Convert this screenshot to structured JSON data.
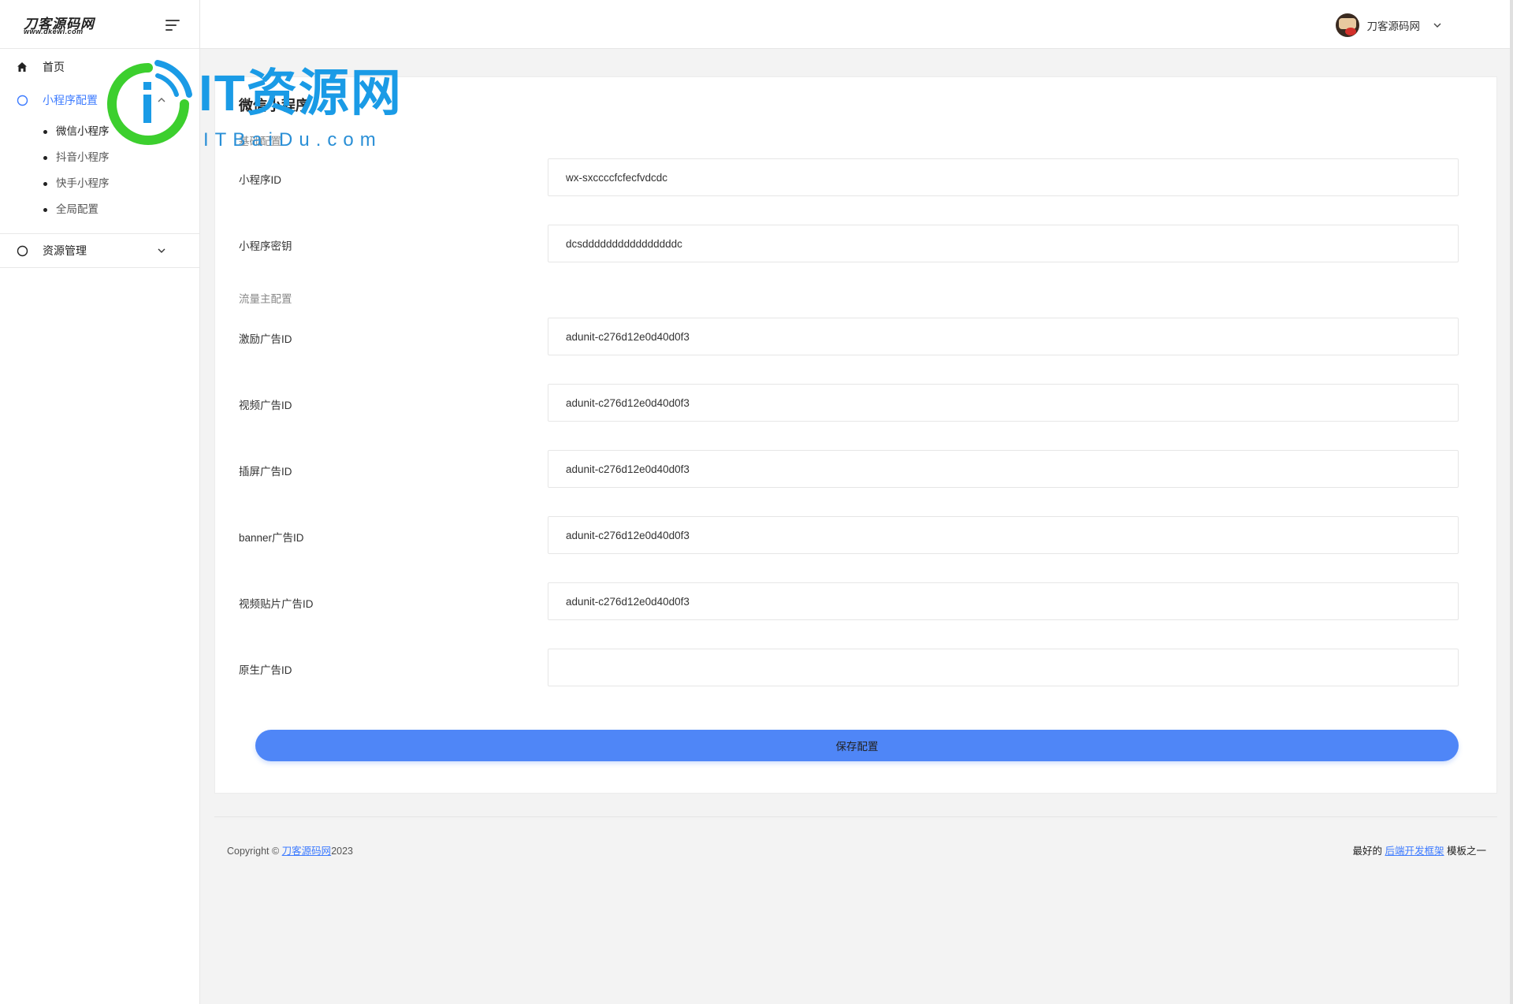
{
  "brand": {
    "name": "刀客源码网",
    "domain": "www.dkewl.com"
  },
  "sidebar": {
    "items": [
      {
        "label": "首页",
        "icon": "home-icon"
      },
      {
        "label": "小程序配置",
        "icon": "circle-icon",
        "expanded": true,
        "children": [
          "微信小程序",
          "抖音小程序",
          "快手小程序",
          "全局配置"
        ],
        "current_child": "微信小程序"
      },
      {
        "label": "资源管理",
        "icon": "circle-icon",
        "expanded": false
      }
    ]
  },
  "header": {
    "username": "刀客源码网"
  },
  "page": {
    "title": "微信小程序",
    "section_basic": "基础配置",
    "section_traffic": "流量主配置",
    "fields": [
      {
        "label": "小程序ID",
        "value": "wx-sxccccfcfecfvdcdc"
      },
      {
        "label": "小程序密钥",
        "value": "dcsddddddddddddddddc"
      },
      {
        "label": "激励广告ID",
        "value": "adunit-c276d12e0d40d0f3"
      },
      {
        "label": "视频广告ID",
        "value": "adunit-c276d12e0d40d0f3"
      },
      {
        "label": "插屏广告ID",
        "value": "adunit-c276d12e0d40d0f3"
      },
      {
        "label": "banner广告ID",
        "value": "adunit-c276d12e0d40d0f3"
      },
      {
        "label": "视频贴片广告ID",
        "value": "adunit-c276d12e0d40d0f3"
      },
      {
        "label": "原生广告ID",
        "value": ""
      }
    ],
    "save_label": "保存配置"
  },
  "footer": {
    "copyright_prefix": "Copyright ©",
    "copyright_link": "刀客源码网",
    "year": "2023",
    "right_prefix": "最好的",
    "right_link": "后端开发框架",
    "right_suffix": "模板之一"
  },
  "watermark": {
    "text": "IT资源网",
    "sub": "ITBaiDu.com"
  },
  "colors": {
    "accent": "#4f86f7",
    "link": "#3d7bff",
    "watermark_green": "#3ccf2e",
    "watermark_blue": "#1a9be6"
  }
}
